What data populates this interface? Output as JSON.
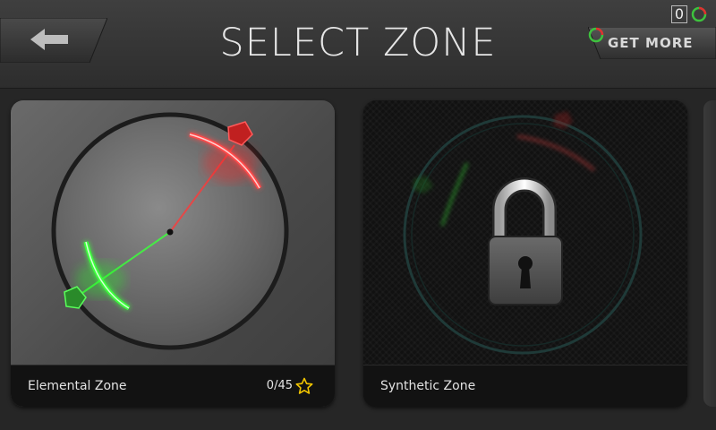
{
  "header": {
    "title": "SELECT ZONE",
    "currency_count": "0",
    "get_more_label": "GET MORE"
  },
  "zones": [
    {
      "name": "Elemental Zone",
      "score": "0/45",
      "locked": false
    },
    {
      "name": "Synthetic Zone",
      "locked": true
    }
  ],
  "colors": {
    "header_bg": "#3a3a3a",
    "red_glow": "#ff3a3a",
    "green_glow": "#3dff3d",
    "star": "#f2c500"
  },
  "icons": {
    "back": "arrow-left-icon",
    "currency": "ring-orb-icon",
    "star": "star-outline-icon",
    "lock": "padlock-icon"
  }
}
